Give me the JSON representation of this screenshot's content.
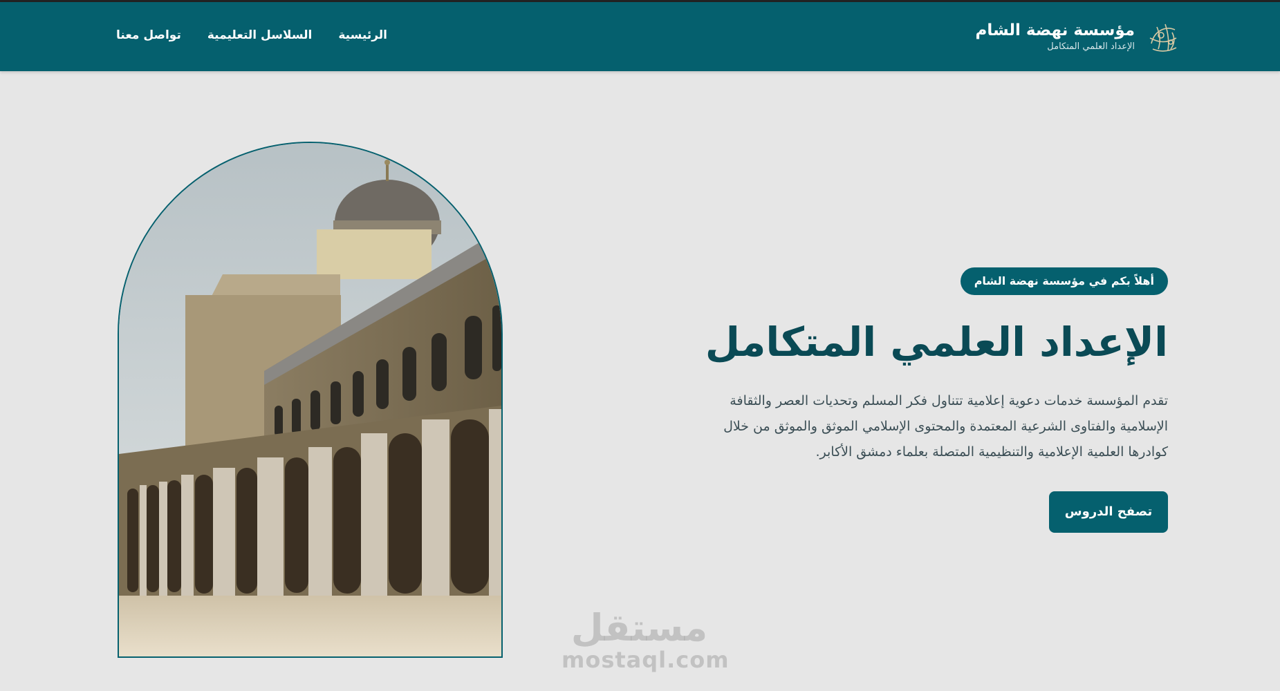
{
  "header": {
    "brand_name": "مؤسسة نهضة الشام",
    "brand_subtitle": "الإعداد العلمي المتكامل",
    "logo_icon": "calligraphy-logo-icon",
    "nav": [
      "الرئيسية",
      "السلاسل التعليمية",
      "تواصل معنا"
    ]
  },
  "hero": {
    "badge": "أهلاً بكم في مؤسسة نهضة الشام",
    "title": "الإعداد العلمي المتكامل",
    "description": "تقدم المؤسسة خدمات دعوية إعلامية تتناول فكر المسلم وتحديات العصر والثقافة الإسلامية والفتاوى الشرعية المعتمدة والمحتوى الإسلامي الموثق والموثق من خلال كوادرها العلمية الإعلامية والتنظيمية المتصلة بعلماء دمشق الأكابر.",
    "cta_label": "تصفح الدروس",
    "image": "umayyad-mosque-photo"
  },
  "watermark": {
    "arabic": "مستقل",
    "latin": "mostaql.com"
  },
  "colors": {
    "primary": "#05606e",
    "background": "#e6e6e6",
    "title": "#0a4a55"
  }
}
